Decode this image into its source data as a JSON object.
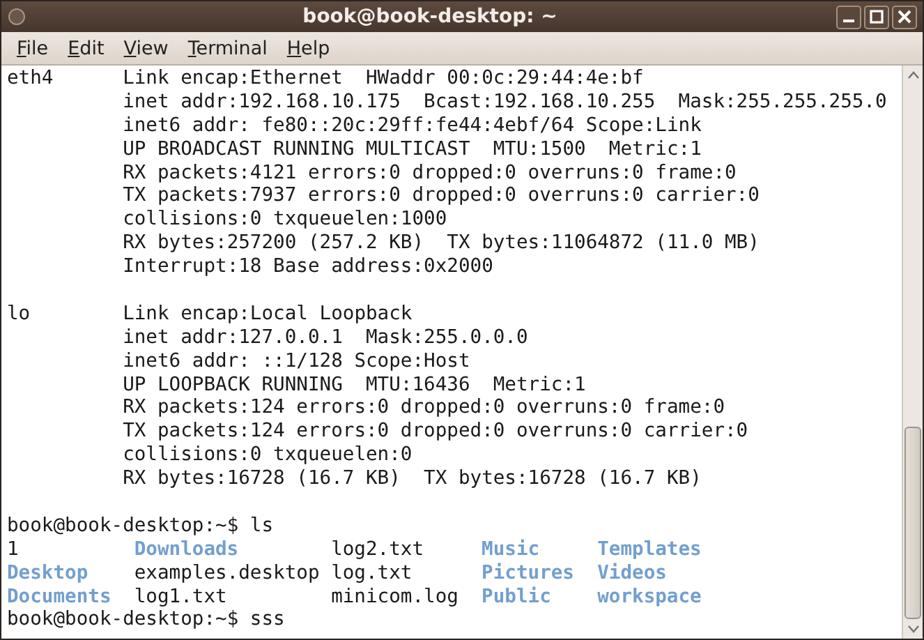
{
  "window": {
    "title": "book@book-desktop: ~"
  },
  "menu": [
    {
      "label": "File"
    },
    {
      "label": "Edit"
    },
    {
      "label": "View"
    },
    {
      "label": "Terminal"
    },
    {
      "label": "Help"
    }
  ],
  "terminal": {
    "lines": [
      {
        "kind": "text",
        "text": "eth4      Link encap:Ethernet  HWaddr 00:0c:29:44:4e:bf"
      },
      {
        "kind": "text",
        "text": "          inet addr:192.168.10.175  Bcast:192.168.10.255  Mask:255.255.255.0"
      },
      {
        "kind": "text",
        "text": "          inet6 addr: fe80::20c:29ff:fe44:4ebf/64 Scope:Link"
      },
      {
        "kind": "text",
        "text": "          UP BROADCAST RUNNING MULTICAST  MTU:1500  Metric:1"
      },
      {
        "kind": "text",
        "text": "          RX packets:4121 errors:0 dropped:0 overruns:0 frame:0"
      },
      {
        "kind": "text",
        "text": "          TX packets:7937 errors:0 dropped:0 overruns:0 carrier:0"
      },
      {
        "kind": "text",
        "text": "          collisions:0 txqueuelen:1000"
      },
      {
        "kind": "text",
        "text": "          RX bytes:257200 (257.2 KB)  TX bytes:11064872 (11.0 MB)"
      },
      {
        "kind": "text",
        "text": "          Interrupt:18 Base address:0x2000"
      },
      {
        "kind": "blank"
      },
      {
        "kind": "text",
        "text": "lo        Link encap:Local Loopback"
      },
      {
        "kind": "text",
        "text": "          inet addr:127.0.0.1  Mask:255.0.0.0"
      },
      {
        "kind": "text",
        "text": "          inet6 addr: ::1/128 Scope:Host"
      },
      {
        "kind": "text",
        "text": "          UP LOOPBACK RUNNING  MTU:16436  Metric:1"
      },
      {
        "kind": "text",
        "text": "          RX packets:124 errors:0 dropped:0 overruns:0 frame:0"
      },
      {
        "kind": "text",
        "text": "          TX packets:124 errors:0 dropped:0 overruns:0 carrier:0"
      },
      {
        "kind": "text",
        "text": "          collisions:0 txqueuelen:0"
      },
      {
        "kind": "text",
        "text": "          RX bytes:16728 (16.7 KB)  TX bytes:16728 (16.7 KB)"
      },
      {
        "kind": "blank"
      },
      {
        "kind": "prompt",
        "text": "book@book-desktop:~$ ls"
      },
      {
        "kind": "listing",
        "entries": [
          {
            "name": "1",
            "kind": "file"
          },
          {
            "name": "Downloads",
            "kind": "dir"
          },
          {
            "name": "log2.txt",
            "kind": "file"
          },
          {
            "name": "Music",
            "kind": "dir"
          },
          {
            "name": "Templates",
            "kind": "dir"
          }
        ]
      },
      {
        "kind": "listing",
        "entries": [
          {
            "name": "Desktop",
            "kind": "dir"
          },
          {
            "name": "examples.desktop",
            "kind": "file"
          },
          {
            "name": "log.txt",
            "kind": "file"
          },
          {
            "name": "Pictures",
            "kind": "dir"
          },
          {
            "name": "Videos",
            "kind": "dir"
          }
        ]
      },
      {
        "kind": "listing",
        "entries": [
          {
            "name": "Documents",
            "kind": "dir"
          },
          {
            "name": "log1.txt",
            "kind": "file"
          },
          {
            "name": "minicom.log",
            "kind": "file"
          },
          {
            "name": "Public",
            "kind": "dir"
          },
          {
            "name": "workspace",
            "kind": "dir"
          }
        ]
      },
      {
        "kind": "prompt",
        "text": "book@book-desktop:~$ sss"
      }
    ]
  }
}
